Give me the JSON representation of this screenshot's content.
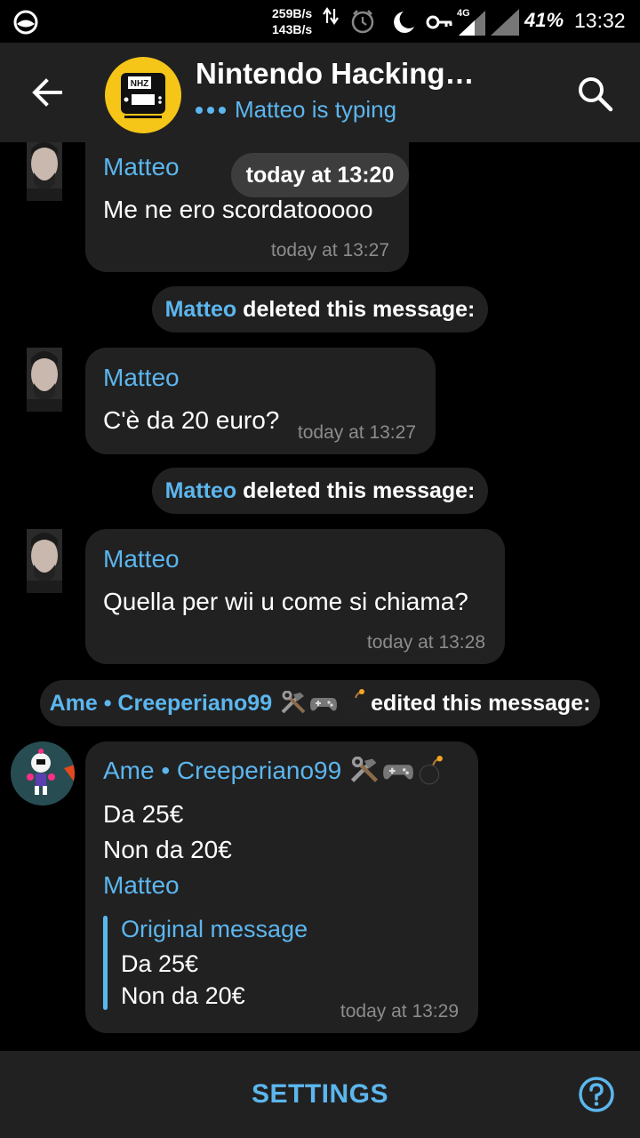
{
  "status_bar": {
    "speed_down": "259B/s",
    "speed_up": "143B/s",
    "network": "4G",
    "battery": "41%",
    "time": "13:32"
  },
  "header": {
    "title": "Nintendo Hacking…",
    "typing": "Matteo is typing",
    "avatar_logo_text": "NHZ"
  },
  "chat": {
    "date_pill": "today at 13:20",
    "messages": [
      {
        "sender": "Matteo",
        "text": "Me ne ero scordatooooo",
        "time": "today at 13:27"
      },
      {
        "sender": "Matteo",
        "text": "C'è da 20 euro?",
        "time": "today at 13:27"
      },
      {
        "sender": "Matteo",
        "text": "Quella per wii u come si chiama?",
        "time": "today at 13:28"
      },
      {
        "sender": "Ame • Creeperiano99",
        "line1": "Da 25€",
        "line2": "Non da 20€",
        "mention": "Matteo",
        "quote_title": "Original message",
        "quote_line1": "Da 25€",
        "quote_line2": "Non da 20€",
        "time": "today at 13:29"
      }
    ],
    "services": [
      {
        "who": "Matteo",
        "what": "deleted this message:"
      },
      {
        "who": "Matteo",
        "what": "deleted this message:"
      },
      {
        "who": "Ame • Creeperiano99",
        "what": "edited this message:"
      }
    ]
  },
  "bottom_bar": {
    "settings_label": "SETTINGS"
  },
  "colors": {
    "accent": "#5cb6ee",
    "bubble": "#212121",
    "header": "#212121",
    "background": "#000000"
  }
}
